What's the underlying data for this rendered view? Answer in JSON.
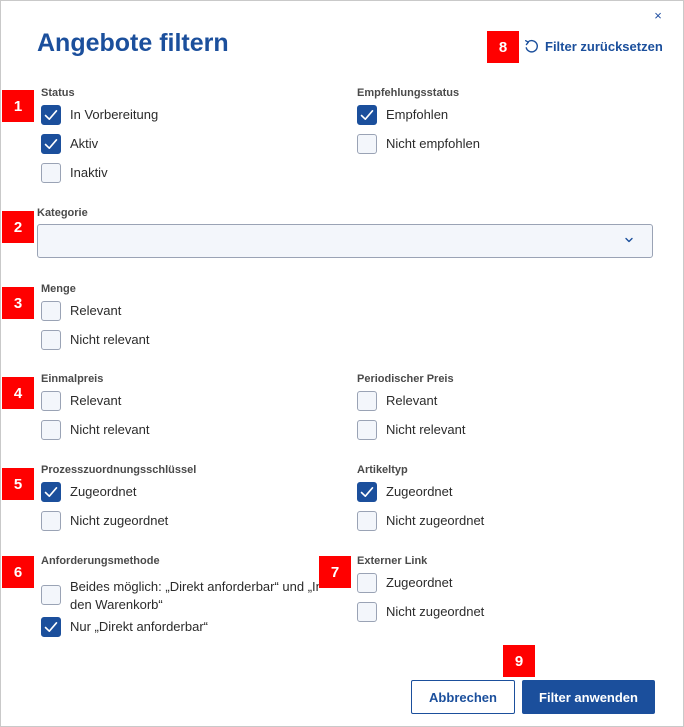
{
  "dialog": {
    "title": "Angebote filtern",
    "close_glyph": "×",
    "reset_label": "Filter zurücksetzen",
    "reset_icon": "undo-icon"
  },
  "accent_color": "#1b4f9c",
  "badge_color": "#ff0000",
  "badges": [
    "1",
    "2",
    "3",
    "4",
    "5",
    "6",
    "7",
    "8",
    "9"
  ],
  "status": {
    "label": "Status",
    "options": [
      {
        "label": "In Vorbereitung",
        "checked": true
      },
      {
        "label": "Aktiv",
        "checked": true
      },
      {
        "label": "Inaktiv",
        "checked": false
      }
    ]
  },
  "empfehlungsstatus": {
    "label": "Empfehlungsstatus",
    "options": [
      {
        "label": "Empfohlen",
        "checked": true
      },
      {
        "label": "Nicht empfohlen",
        "checked": false
      }
    ]
  },
  "kategorie": {
    "label": "Kategorie",
    "value": ""
  },
  "menge": {
    "label": "Menge",
    "options": [
      {
        "label": "Relevant",
        "checked": false
      },
      {
        "label": "Nicht relevant",
        "checked": false
      }
    ]
  },
  "einmalpreis": {
    "label": "Einmalpreis",
    "options": [
      {
        "label": "Relevant",
        "checked": false
      },
      {
        "label": "Nicht relevant",
        "checked": false
      }
    ]
  },
  "periodischer_preis": {
    "label": "Periodischer Preis",
    "options": [
      {
        "label": "Relevant",
        "checked": false
      },
      {
        "label": "Nicht relevant",
        "checked": false
      }
    ]
  },
  "prozesszuordnungsschluessel": {
    "label": "Prozesszuordnungsschlüssel",
    "options": [
      {
        "label": "Zugeordnet",
        "checked": true
      },
      {
        "label": "Nicht zugeordnet",
        "checked": false
      }
    ]
  },
  "artikeltyp": {
    "label": "Artikeltyp",
    "options": [
      {
        "label": "Zugeordnet",
        "checked": true
      },
      {
        "label": "Nicht zugeordnet",
        "checked": false
      }
    ]
  },
  "anforderungsmethode": {
    "label": "Anforderungsmethode",
    "options": [
      {
        "label_line1": "Beides möglich: „Direkt anforderbar“ und „In",
        "label_line2": "den Warenkorb“",
        "checked": false
      },
      {
        "label": "Nur „Direkt anforderbar“",
        "checked": true
      }
    ]
  },
  "externer_link": {
    "label": "Externer Link",
    "options": [
      {
        "label": "Zugeordnet",
        "checked": false
      },
      {
        "label": "Nicht zugeordnet",
        "checked": false
      }
    ]
  },
  "footer": {
    "cancel_label": "Abbrechen",
    "apply_label": "Filter anwenden"
  }
}
